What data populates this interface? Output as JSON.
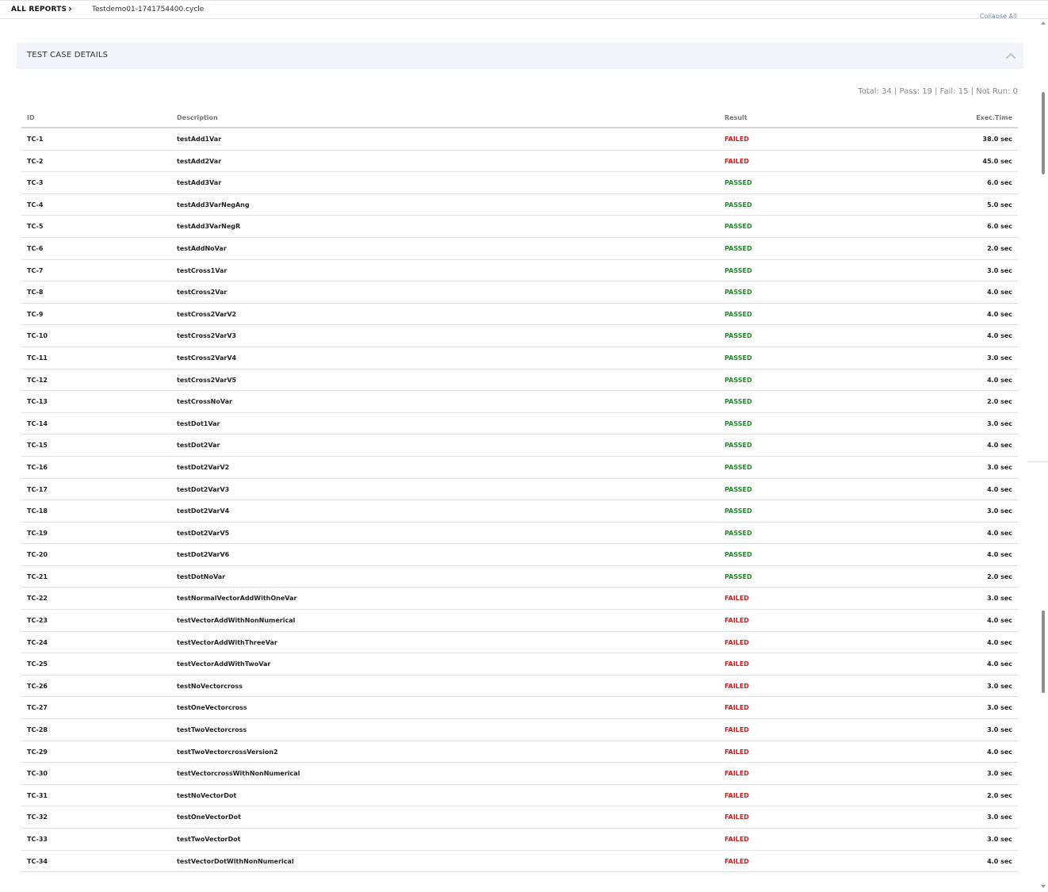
{
  "breadcrumb": {
    "root_label": "ALL REPORTS",
    "separator": "›",
    "current_label": "Testdemo01-1741754400.cycle"
  },
  "toolbar": {
    "collapse_all_label": "Collapse All"
  },
  "panel": {
    "title": "TEST CASE DETAILS",
    "toggle_icon": "chevron-up-icon"
  },
  "summary": {
    "text": "Total: 34 | Pass: 19 | Fail: 15 | Not Run: 0"
  },
  "table": {
    "headers": {
      "id": "ID",
      "description": "Description",
      "result": "Result",
      "exec_time": "Exec.Time"
    },
    "rows": [
      {
        "id": "TC-1",
        "description": "testAdd1Var",
        "result": "FAILED",
        "exec_time": "38.0 sec"
      },
      {
        "id": "TC-2",
        "description": "testAdd2Var",
        "result": "FAILED",
        "exec_time": "45.0 sec"
      },
      {
        "id": "TC-3",
        "description": "testAdd3Var",
        "result": "PASSED",
        "exec_time": "6.0 sec"
      },
      {
        "id": "TC-4",
        "description": "testAdd3VarNegAng",
        "result": "PASSED",
        "exec_time": "5.0 sec"
      },
      {
        "id": "TC-5",
        "description": "testAdd3VarNegR",
        "result": "PASSED",
        "exec_time": "6.0 sec"
      },
      {
        "id": "TC-6",
        "description": "testAddNoVar",
        "result": "PASSED",
        "exec_time": "2.0 sec"
      },
      {
        "id": "TC-7",
        "description": "testCross1Var",
        "result": "PASSED",
        "exec_time": "3.0 sec"
      },
      {
        "id": "TC-8",
        "description": "testCross2Var",
        "result": "PASSED",
        "exec_time": "4.0 sec"
      },
      {
        "id": "TC-9",
        "description": "testCross2VarV2",
        "result": "PASSED",
        "exec_time": "4.0 sec"
      },
      {
        "id": "TC-10",
        "description": "testCross2VarV3",
        "result": "PASSED",
        "exec_time": "4.0 sec"
      },
      {
        "id": "TC-11",
        "description": "testCross2VarV4",
        "result": "PASSED",
        "exec_time": "3.0 sec"
      },
      {
        "id": "TC-12",
        "description": "testCross2VarV5",
        "result": "PASSED",
        "exec_time": "4.0 sec"
      },
      {
        "id": "TC-13",
        "description": "testCrossNoVar",
        "result": "PASSED",
        "exec_time": "2.0 sec"
      },
      {
        "id": "TC-14",
        "description": "testDot1Var",
        "result": "PASSED",
        "exec_time": "3.0 sec"
      },
      {
        "id": "TC-15",
        "description": "testDot2Var",
        "result": "PASSED",
        "exec_time": "4.0 sec"
      },
      {
        "id": "TC-16",
        "description": "testDot2VarV2",
        "result": "PASSED",
        "exec_time": "3.0 sec"
      },
      {
        "id": "TC-17",
        "description": "testDot2VarV3",
        "result": "PASSED",
        "exec_time": "4.0 sec"
      },
      {
        "id": "TC-18",
        "description": "testDot2VarV4",
        "result": "PASSED",
        "exec_time": "3.0 sec"
      },
      {
        "id": "TC-19",
        "description": "testDot2VarV5",
        "result": "PASSED",
        "exec_time": "4.0 sec"
      },
      {
        "id": "TC-20",
        "description": "testDot2VarV6",
        "result": "PASSED",
        "exec_time": "4.0 sec"
      },
      {
        "id": "TC-21",
        "description": "testDotNoVar",
        "result": "PASSED",
        "exec_time": "2.0 sec"
      },
      {
        "id": "TC-22",
        "description": "testNormalVectorAddWithOneVar",
        "result": "FAILED",
        "exec_time": "3.0 sec"
      },
      {
        "id": "TC-23",
        "description": "testVectorAddWithNonNumerical",
        "result": "FAILED",
        "exec_time": "4.0 sec"
      },
      {
        "id": "TC-24",
        "description": "testVectorAddWithThreeVar",
        "result": "FAILED",
        "exec_time": "4.0 sec"
      },
      {
        "id": "TC-25",
        "description": "testVectorAddWithTwoVar",
        "result": "FAILED",
        "exec_time": "4.0 sec"
      },
      {
        "id": "TC-26",
        "description": "testNoVectorcross",
        "result": "FAILED",
        "exec_time": "3.0 sec"
      },
      {
        "id": "TC-27",
        "description": "testOneVectorcross",
        "result": "FAILED",
        "exec_time": "3.0 sec"
      },
      {
        "id": "TC-28",
        "description": "testTwoVectorcross",
        "result": "FAILED",
        "exec_time": "3.0 sec"
      },
      {
        "id": "TC-29",
        "description": "testTwoVectorcrossVersion2",
        "result": "FAILED",
        "exec_time": "4.0 sec"
      },
      {
        "id": "TC-30",
        "description": "testVectorcrossWithNonNumerical",
        "result": "FAILED",
        "exec_time": "3.0 sec"
      },
      {
        "id": "TC-31",
        "description": "testNoVectorDot",
        "result": "FAILED",
        "exec_time": "2.0 sec"
      },
      {
        "id": "TC-32",
        "description": "testOneVectorDot",
        "result": "FAILED",
        "exec_time": "3.0 sec"
      },
      {
        "id": "TC-33",
        "description": "testTwoVectorDot",
        "result": "FAILED",
        "exec_time": "3.0 sec"
      },
      {
        "id": "TC-34",
        "description": "testVectorDotWithNonNumerical",
        "result": "FAILED",
        "exec_time": "4.0 sec"
      }
    ]
  },
  "colors": {
    "failed": "#cc1f1f",
    "passed": "#1f8a2a",
    "panel_header_bg": "#f3f3fa"
  }
}
